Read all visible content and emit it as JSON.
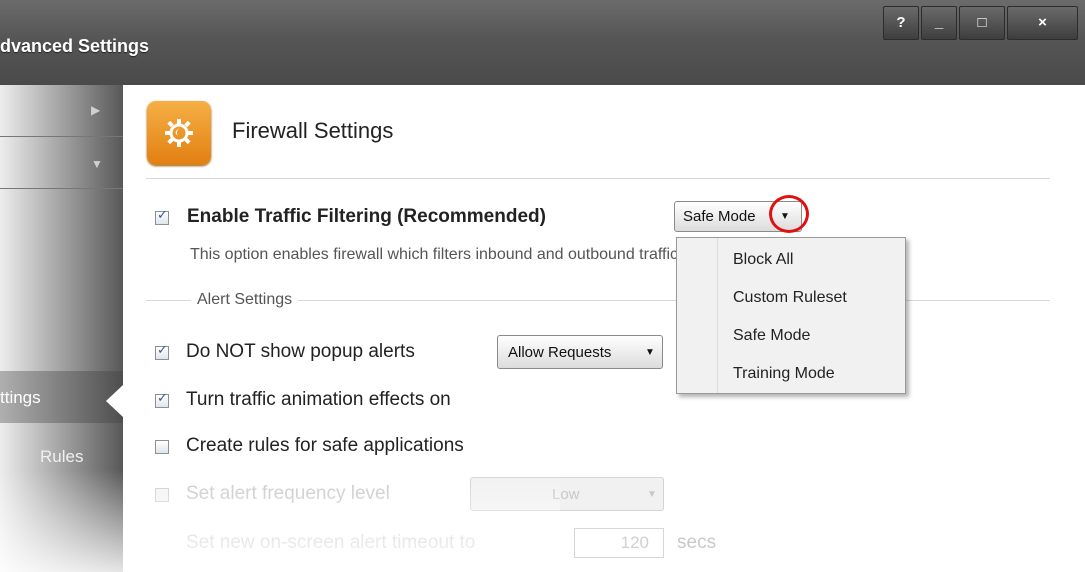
{
  "window": {
    "title": "dvanced Settings",
    "buttons": {
      "help": "?",
      "minimize": "_",
      "maximize": "□",
      "close": "×"
    }
  },
  "sidebar": {
    "items": [
      {
        "label": "",
        "arrow": "▶"
      },
      {
        "label": "",
        "arrow": "▼"
      },
      {
        "label": "ttings",
        "arrow": ""
      },
      {
        "label": "Rules",
        "arrow": ""
      }
    ]
  },
  "header": {
    "title": "Firewall Settings",
    "icon": "firewall-gear-icon",
    "icon_color": "#ef9a28"
  },
  "enable_filtering": {
    "label": "Enable Traffic Filtering (Recommended)",
    "checked": true,
    "mode": "Safe Mode",
    "description": "This option enables firewall which filters inbound and outbound traffic"
  },
  "mode_menu": {
    "items": [
      "Block All",
      "Custom Ruleset",
      "Safe Mode",
      "Training Mode"
    ]
  },
  "alert_settings": {
    "title": "Alert Settings",
    "options": [
      {
        "label": "Do NOT show popup alerts",
        "checked": true,
        "enabled": true,
        "dropdown": "Allow Requests"
      },
      {
        "label": "Turn traffic animation effects on",
        "checked": true,
        "enabled": true
      },
      {
        "label": "Create rules for safe applications",
        "checked": false,
        "enabled": true
      },
      {
        "label": "Set alert frequency level",
        "checked": false,
        "enabled": false,
        "dropdown": "Low"
      },
      {
        "label": "Set new on-screen alert timeout to",
        "checked": false,
        "enabled": false,
        "value": "120",
        "unit": "secs"
      }
    ]
  },
  "colors": {
    "highlight_circle": "#e01010",
    "titlebar": "#555555",
    "accent": "#ef9a28"
  }
}
